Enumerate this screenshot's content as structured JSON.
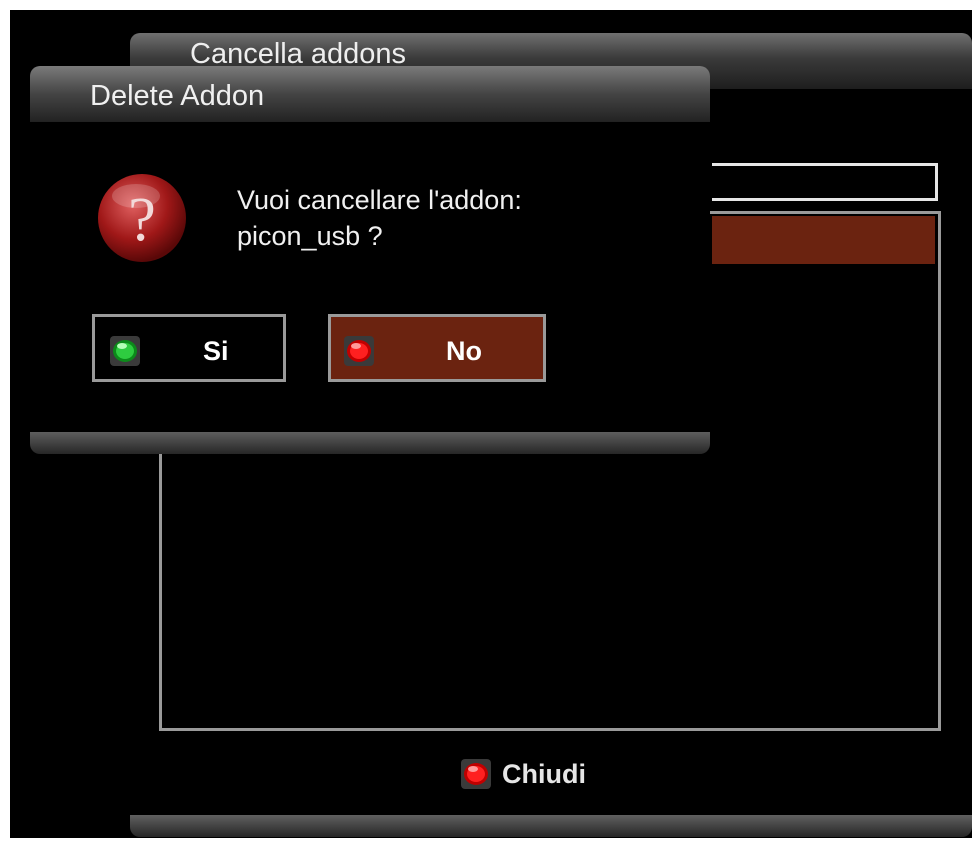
{
  "background_window": {
    "title": "Cancella addons",
    "hint": {
      "icon": "red-button-icon",
      "label": "Chiudi"
    }
  },
  "dialog": {
    "title": "Delete Addon",
    "icon": "question-icon",
    "message_line1": "Vuoi cancellare l'addon:",
    "message_line2": "picon_usb ?",
    "buttons": [
      {
        "label": "Si",
        "icon": "green-button-icon",
        "selected": false
      },
      {
        "label": "No",
        "icon": "red-button-icon",
        "selected": true
      }
    ]
  },
  "colors": {
    "selection": "#6b2310",
    "green_led": "#2ecc40",
    "red_led": "#e60000"
  }
}
